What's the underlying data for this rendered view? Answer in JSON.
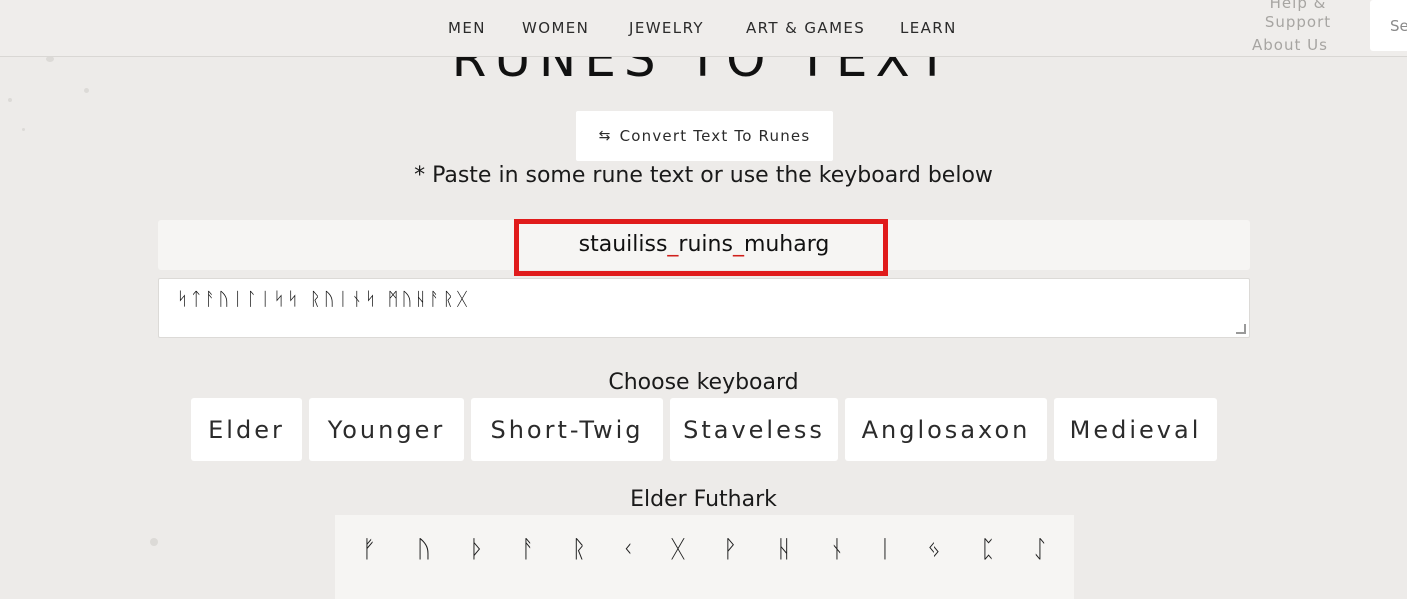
{
  "nav": {
    "items": [
      "MEN",
      "WOMEN",
      "JEWELRY",
      "ART & GAMES",
      "LEARN"
    ],
    "help": "Help & Support",
    "about": "About Us",
    "search_placeholder": "Se"
  },
  "title": "RUNES TO TEXT",
  "convert_button": {
    "icon": "swap-arrows-icon",
    "label": "Convert Text To Runes"
  },
  "instruction": "* Paste in some rune text or use the keyboard below",
  "output": {
    "part1": "stauiliss",
    "sep1": "_",
    "part2": "ruins",
    "sep2": "_",
    "part3": "muharg"
  },
  "rune_input_value": "ᛋᛏᚨᚢᛁᛚᛁᛋᛋ ᚱᚢᛁᚾᛋ ᛗᚢᚺᚨᚱᚷ",
  "choose_keyboard_label": "Choose keyboard",
  "keyboards": [
    "Elder",
    "Younger",
    "Short-Twig",
    "Staveless",
    "Anglosaxon",
    "Medieval"
  ],
  "keyboard_title": "Elder Futhark",
  "runes": [
    "ᚠ",
    "ᚢ",
    "ᚦ",
    "ᚨ",
    "ᚱ",
    "ᚲ",
    "ᚷ",
    "ᚹ",
    "ᚺ",
    "ᚾ",
    "ᛁ",
    "ᛃ",
    "ᛈ",
    "ᛇ"
  ]
}
